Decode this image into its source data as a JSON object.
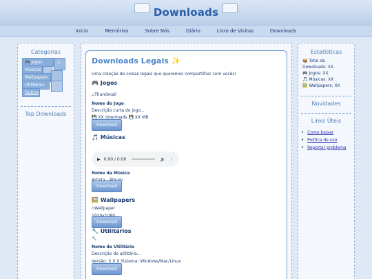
{
  "header": {
    "title": "Downloads"
  },
  "nav": {
    "items": [
      "Início",
      "Memórias",
      "Sobre Nós",
      "Diário",
      "Livro de Visitas",
      "Downloads"
    ]
  },
  "left": {
    "categories_title": "Categorias",
    "categories": [
      "🎮 Jogos",
      "Músicas",
      "Wallpapers",
      "Utilitários",
      "Outros"
    ],
    "top_title": "Top Downloads"
  },
  "main": {
    "title": "Downloads Legais ✨",
    "intro": "Uma coleção de coisas legais que queremos compartilhar com vocês!",
    "games": {
      "heading": "🎮 Jogos",
      "thumb_alt": "Thumbnail",
      "name": "Nome do Jogo",
      "desc": "Descrição curta do jogo...",
      "meta": "💾 XX downloads 💾 XX MB",
      "button": "Download"
    },
    "music": {
      "heading": "🎵 Músicas",
      "time": "0:00 / 0:00",
      "name": "Nome da Música",
      "artist": "Artista - Álbum",
      "button": "Download"
    },
    "wallpapers": {
      "heading": "🖼️ Wallpapers",
      "img_alt": "Wallpaper",
      "size": "1920x1080",
      "button": "Download"
    },
    "utils": {
      "heading": "🔧 Utilitários",
      "icon": "🔧",
      "name": "Nome do Utilitário",
      "desc": "Descrição do utilitário...",
      "version": "Versão: X.X.X Sistema: Windows/Mac/Linux",
      "button": "Download"
    }
  },
  "right": {
    "stats_title": "Estatísticas",
    "stats": [
      "📦 Total de Downloads: XX",
      "🎮 Jogos: XX",
      "🎵 Músicas: XX",
      "🖼️ Wallpapers: XX"
    ],
    "news_title": "Novidades",
    "links_title": "Links Úteis",
    "links": [
      "Como baixar",
      "Política de uso",
      "Reportar problema"
    ]
  }
}
